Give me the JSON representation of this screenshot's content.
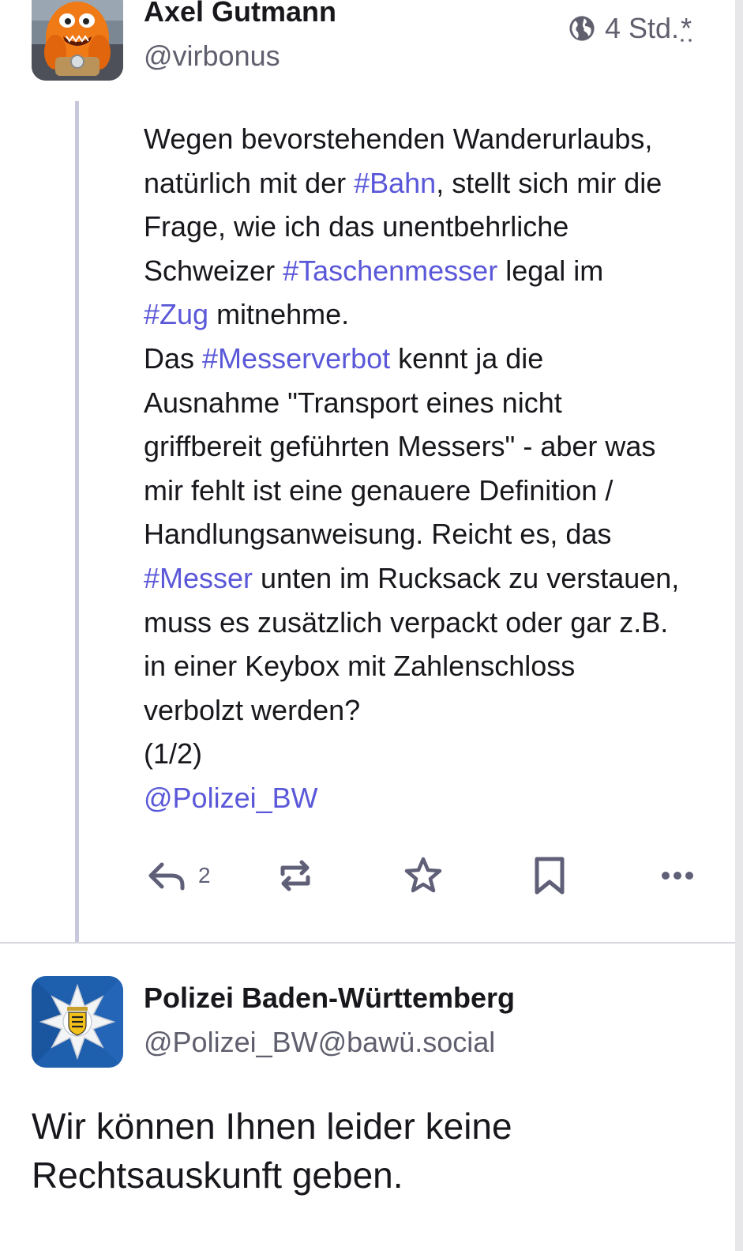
{
  "post": {
    "author": {
      "display_name": "Axel Gutmann",
      "handle": "@virbonus",
      "avatar": "orange-furry-monster-on-bicycle"
    },
    "visibility_icon": "globe-icon",
    "timestamp": "4 Std.",
    "timestamp_suffix": "*",
    "body_lines": [
      [
        {
          "t": "Wegen bevorstehenden Wanderurlaubs,"
        }
      ],
      [
        {
          "t": "natürlich mit der "
        },
        {
          "t": "#Bahn",
          "k": "tag"
        },
        {
          "t": ", stellt sich mir die"
        }
      ],
      [
        {
          "t": "Frage, wie ich das unentbehrliche"
        }
      ],
      [
        {
          "t": "Schweizer "
        },
        {
          "t": "#Taschenmesser",
          "k": "tag"
        },
        {
          "t": " legal im"
        }
      ],
      [
        {
          "t": "#Zug",
          "k": "tag"
        },
        {
          "t": " mitnehme."
        }
      ],
      [
        {
          "t": "Das "
        },
        {
          "t": "#Messerverbot",
          "k": "tag"
        },
        {
          "t": " kennt ja die"
        }
      ],
      [
        {
          "t": "Ausnahme \"Transport eines nicht"
        }
      ],
      [
        {
          "t": "griffbereit geführten Messers\" - aber was"
        }
      ],
      [
        {
          "t": "mir fehlt ist eine genauere Definition /"
        }
      ],
      [
        {
          "t": "Handlungsanweisung. Reicht es, das"
        }
      ],
      [
        {
          "t": "#Messer",
          "k": "tag"
        },
        {
          "t": " unten im Rucksack zu verstauen,"
        }
      ],
      [
        {
          "t": "muss es zusätzlich verpackt oder gar z.B."
        }
      ],
      [
        {
          "t": "in einer Keybox mit Zahlenschloss"
        }
      ],
      [
        {
          "t": "verbolzt werden?"
        }
      ],
      [
        {
          "t": "(1/2)"
        }
      ],
      [
        {
          "t": "@Polizei_BW",
          "k": "mention"
        }
      ]
    ],
    "actions": {
      "reply_icon": "reply-icon",
      "reply_count": "2",
      "boost_icon": "boost-icon",
      "favourite_icon": "star-icon",
      "bookmark_icon": "bookmark-icon",
      "more_icon": "more-icon"
    }
  },
  "reply": {
    "author": {
      "display_name": "Polizei Baden-Württemberg",
      "handle": "@Polizei_BW@bawü.social",
      "avatar": "police-star-emblem"
    },
    "text_lines": [
      "Wir können Ihnen leider keine",
      "Rechtsauskunft geben."
    ]
  },
  "colors": {
    "accent": "#5a58d8",
    "text": "#17171c",
    "muted": "#5f5f6e",
    "thread_line": "#c8c8dc",
    "police_blue": "#1e5fae"
  }
}
